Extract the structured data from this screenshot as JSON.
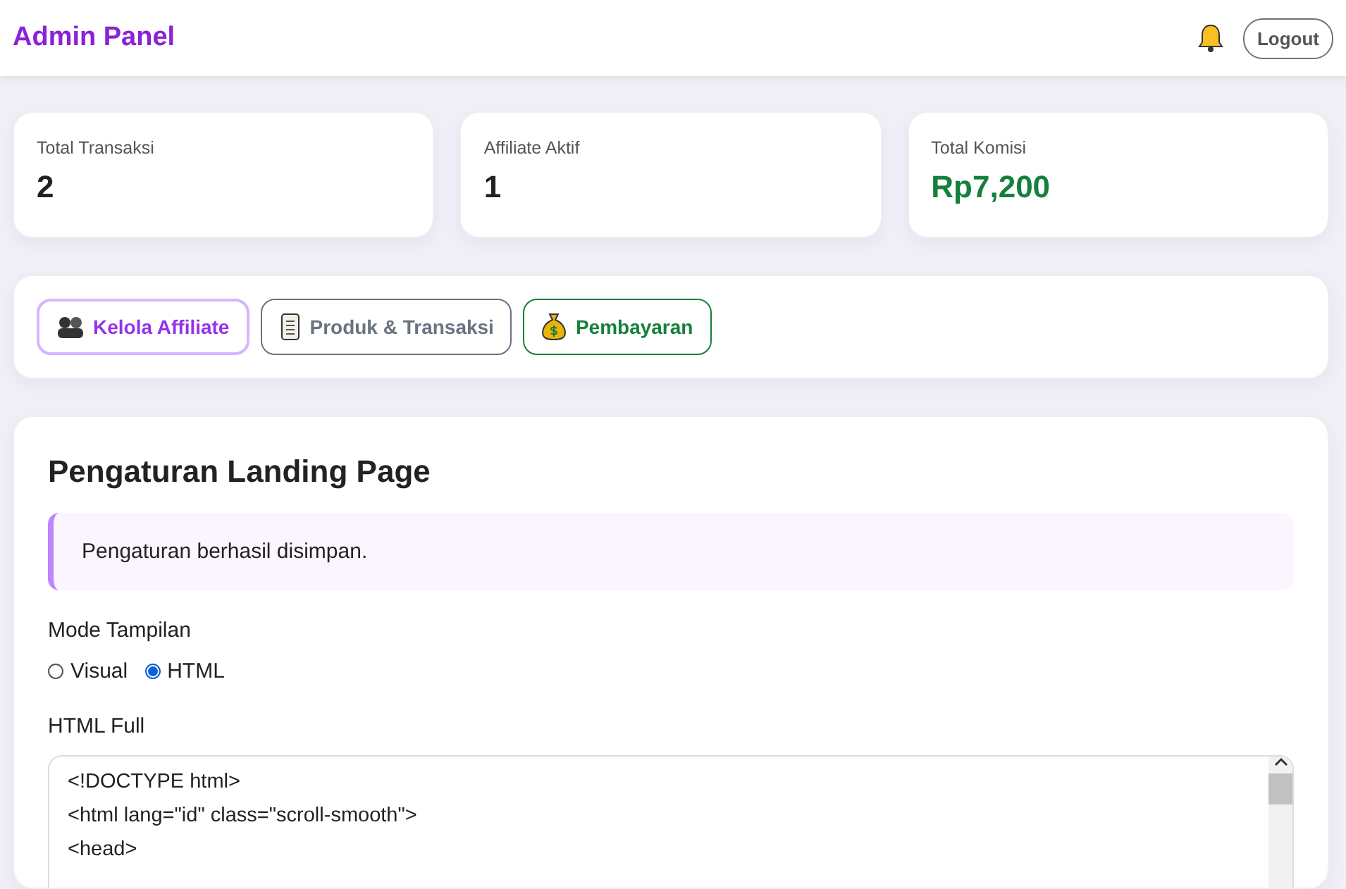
{
  "header": {
    "title": "Admin Panel",
    "logout": "Logout"
  },
  "stats": [
    {
      "label": "Total Transaksi",
      "value": "2",
      "kind": "plain"
    },
    {
      "label": "Affiliate Aktif",
      "value": "1",
      "kind": "plain"
    },
    {
      "label": "Total Komisi",
      "value": "Rp7,200",
      "kind": "money"
    }
  ],
  "tabs": [
    {
      "label": "Kelola Affiliate",
      "selected": true,
      "color": "#9333ea",
      "kind": "people"
    },
    {
      "label": "Produk & Transaksi",
      "selected": false,
      "color": "#6b7280",
      "kind": "scroll"
    },
    {
      "label": "Pembayaran",
      "selected": false,
      "color": "#15803d",
      "kind": "moneybag"
    }
  ],
  "settings": {
    "title": "Pengaturan Landing Page",
    "alert": "Pengaturan berhasil disimpan.",
    "mode_label": "Mode Tampilan",
    "modes": [
      {
        "label": "Visual",
        "selected": false
      },
      {
        "label": "HTML",
        "selected": true
      }
    ],
    "html_label": "HTML Full",
    "code_lines": [
      "<!DOCTYPE html>",
      "<html lang=\"id\" class=\"scroll-smooth\">",
      "<head>"
    ]
  }
}
